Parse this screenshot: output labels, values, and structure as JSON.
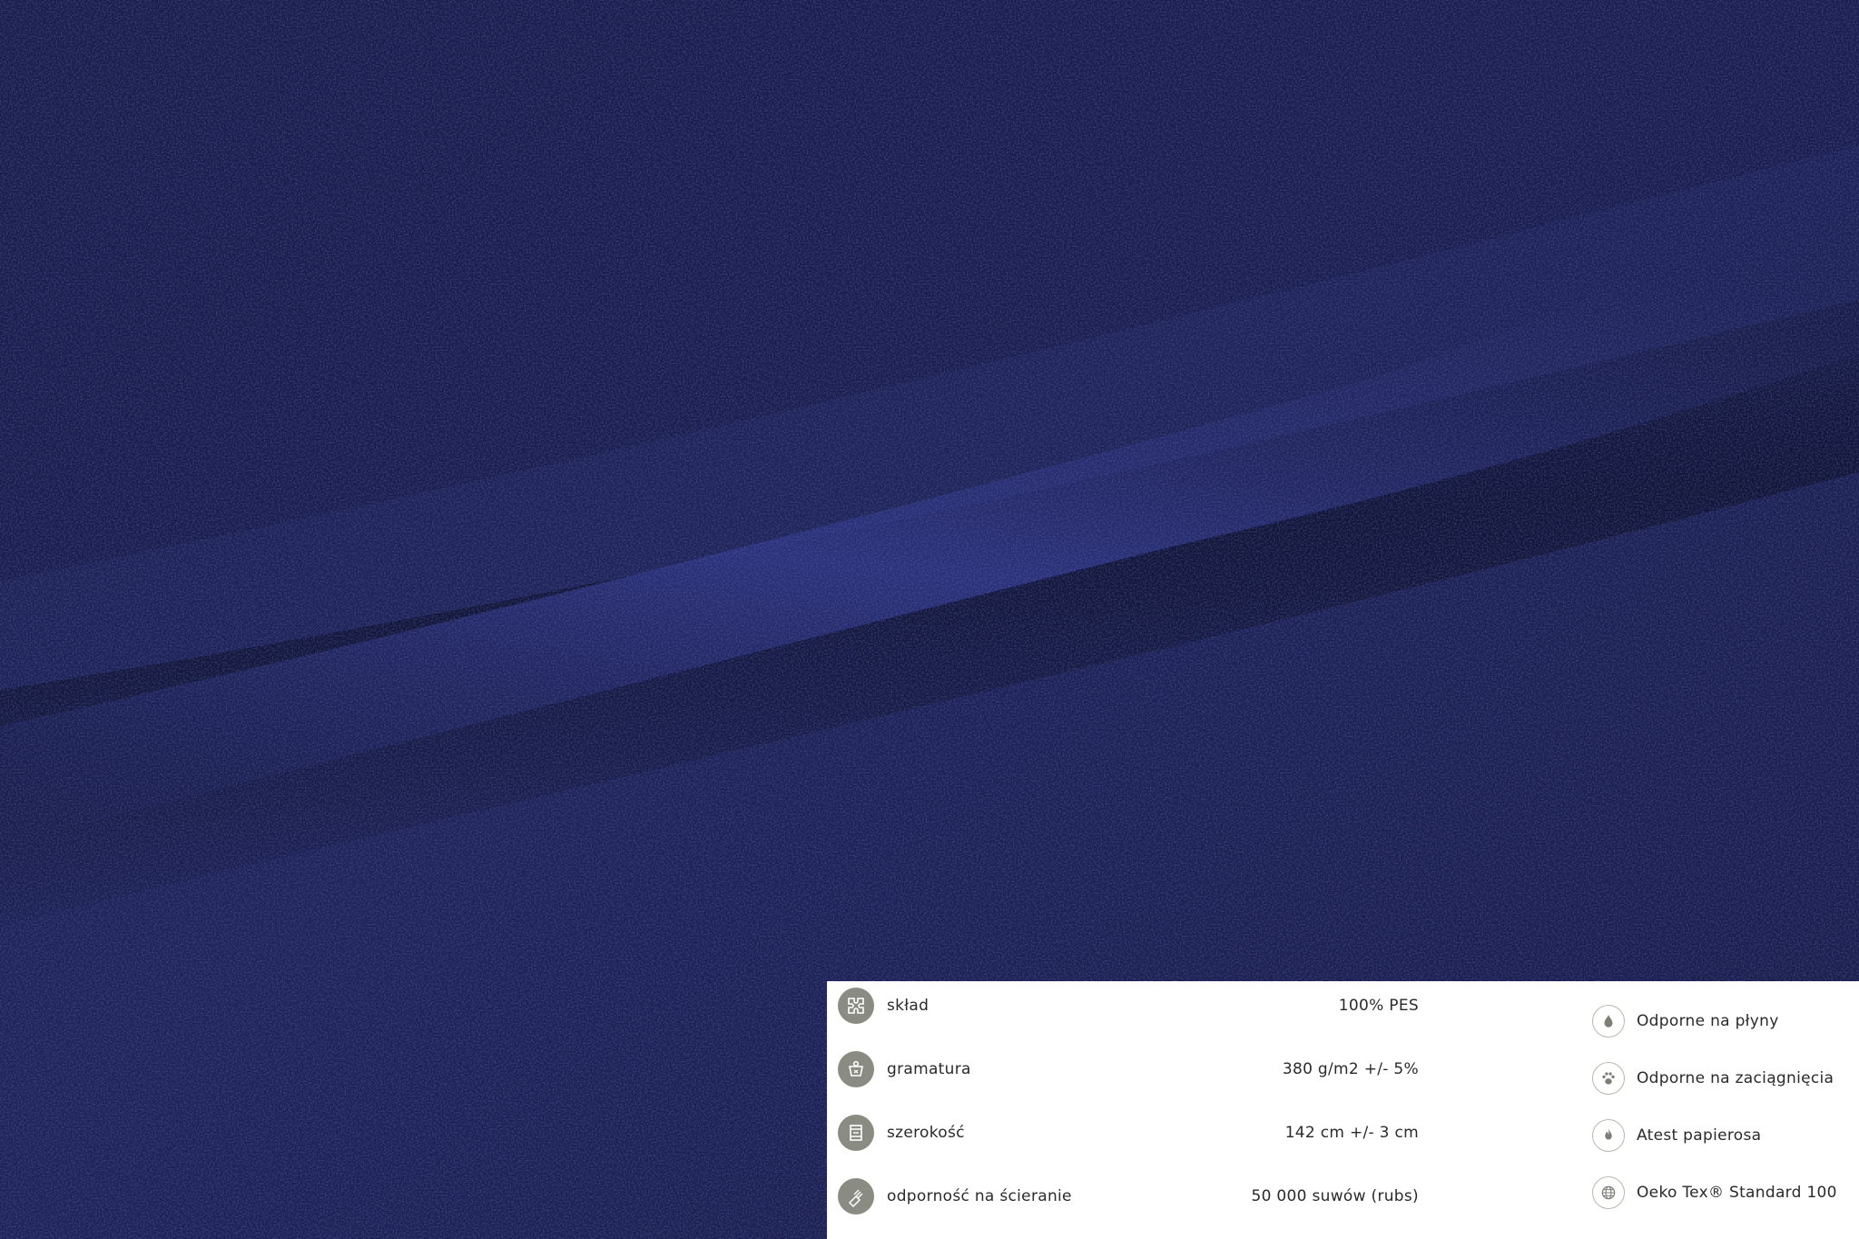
{
  "colors": {
    "fabric_dark": "#141840",
    "fabric_mid": "#232a66",
    "fabric_highlight": "#33398a",
    "panel_bg": "#ffffff",
    "icon_fill": "#8a8b82",
    "text": "#2a2a2a"
  },
  "specs": [
    {
      "icon": "puzzle-composition-icon",
      "label": "skład",
      "value": "100% PES"
    },
    {
      "icon": "weight-icon",
      "label": "gramatura",
      "value": "380 g/m2 +/- 5%"
    },
    {
      "icon": "width-roll-icon",
      "label": "szerokość",
      "value": "142 cm +/- 3 cm"
    },
    {
      "icon": "abrasion-icon",
      "label": "odporność na ścieranie",
      "value": "50 000 suwów (rubs)"
    }
  ],
  "features": [
    {
      "icon": "drop-icon",
      "label": "Odporne na płyny"
    },
    {
      "icon": "paw-icon",
      "label": "Odporne na zaciągnięcia"
    },
    {
      "icon": "flame-icon",
      "label": "Atest papierosa"
    },
    {
      "icon": "globe-icon",
      "label": "Oeko Tex® Standard 100"
    }
  ]
}
